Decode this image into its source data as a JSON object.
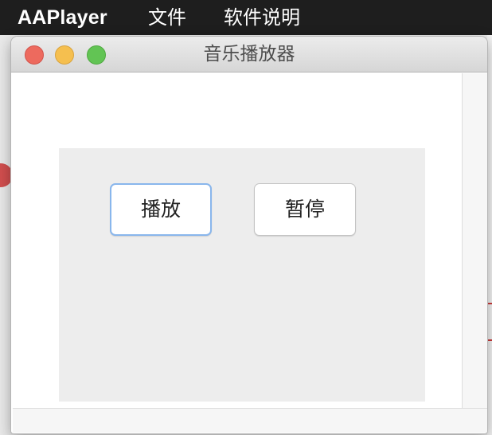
{
  "menubar": {
    "app_name": "AAPlayer",
    "items": [
      {
        "label": "文件"
      },
      {
        "label": "软件说明"
      }
    ]
  },
  "window": {
    "title": "音乐播放器",
    "controls": {
      "close": "close-icon",
      "minimize": "minimize-icon",
      "maximize": "maximize-icon"
    }
  },
  "player": {
    "play_label": "播放",
    "pause_label": "暂停"
  },
  "colors": {
    "menubar_bg": "#1e1e1e",
    "close": "#ed6a5e",
    "minimize": "#f5bf4f",
    "maximize": "#62c454",
    "focus_ring": "#89b6ec",
    "panel_bg": "#ededed"
  }
}
